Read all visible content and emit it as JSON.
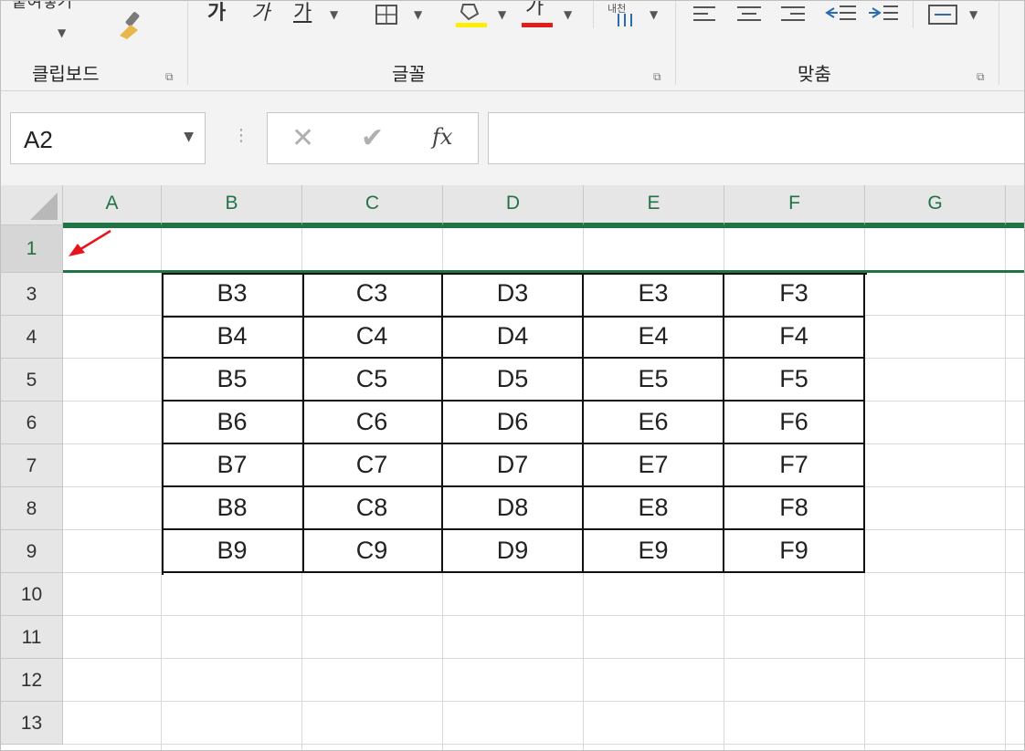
{
  "ribbon": {
    "paste_label": "붙여넣기",
    "groups": {
      "clipboard": "클립보드",
      "font": "글꼴",
      "alignment": "맞춤"
    },
    "font_buttons": {
      "bold": "가",
      "italic": "가",
      "underline": "가",
      "fill_color": "#ffee00",
      "font_color": "#e41c1c",
      "font_color_glyph": "가",
      "phonetic": "내천"
    }
  },
  "formula_bar": {
    "name_box": "A2",
    "cancel": "✕",
    "enter": "✔",
    "fx": "fx",
    "value": ""
  },
  "grid": {
    "columns": [
      "A",
      "B",
      "C",
      "D",
      "E",
      "F",
      "G"
    ],
    "rows": [
      "1",
      "3",
      "4",
      "5",
      "6",
      "7",
      "8",
      "9",
      "10",
      "11",
      "12",
      "13"
    ],
    "selected_row": "1",
    "table": [
      [
        "B3",
        "C3",
        "D3",
        "E3",
        "F3"
      ],
      [
        "B4",
        "C4",
        "D4",
        "E4",
        "F4"
      ],
      [
        "B5",
        "C5",
        "D5",
        "E5",
        "F5"
      ],
      [
        "B6",
        "C6",
        "D6",
        "E6",
        "F6"
      ],
      [
        "B7",
        "C7",
        "D7",
        "E7",
        "F7"
      ],
      [
        "B8",
        "C8",
        "D8",
        "E8",
        "F8"
      ],
      [
        "B9",
        "C9",
        "D9",
        "E9",
        "F9"
      ]
    ]
  },
  "colors": {
    "accent": "#217346",
    "annotation_arrow": "#e8141c"
  }
}
